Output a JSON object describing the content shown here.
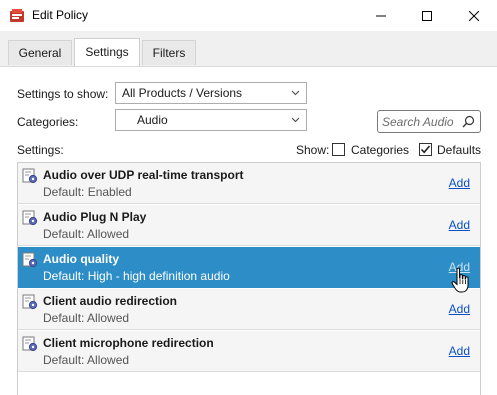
{
  "window": {
    "title": "Edit Policy",
    "controls": {
      "minimize": "minimize",
      "maximize": "maximize",
      "close": "close"
    }
  },
  "tabs": [
    {
      "label": "General",
      "selected": false
    },
    {
      "label": "Settings",
      "selected": true
    },
    {
      "label": "Filters",
      "selected": false
    }
  ],
  "filters": {
    "settings_to_show_label": "Settings to show:",
    "settings_to_show_value": "All Products / Versions",
    "categories_label": "Categories:",
    "categories_value": "Audio",
    "search_placeholder": "Search Audio",
    "search_value": ""
  },
  "settings_header": {
    "label": "Settings:",
    "show_label": "Show:",
    "categories_checkbox_label": "Categories",
    "categories_checked": false,
    "defaults_checkbox_label": "Defaults",
    "defaults_checked": true
  },
  "settings_list": [
    {
      "name": "Audio over UDP real-time transport",
      "default": "Default: Enabled",
      "action": "Add",
      "selected": false
    },
    {
      "name": "Audio Plug N Play",
      "default": "Default: Allowed",
      "action": "Add",
      "selected": false
    },
    {
      "name": "Audio quality",
      "default": "Default: High - high definition audio",
      "action": "Add",
      "selected": true
    },
    {
      "name": "Client audio redirection",
      "default": "Default: Allowed",
      "action": "Add",
      "selected": false
    },
    {
      "name": "Client microphone redirection",
      "default": "Default: Allowed",
      "action": "Add",
      "selected": false
    }
  ],
  "colors": {
    "selection": "#2d8dc7",
    "link": "#0b4fc5",
    "row_background": "#f5f5f5"
  },
  "icons": {
    "app": "policy-app-icon",
    "setting": "setting-gear-icon",
    "search": "magnifier-icon",
    "dropdown": "chevron-down-icon",
    "cursor": "hand-pointer-icon"
  }
}
